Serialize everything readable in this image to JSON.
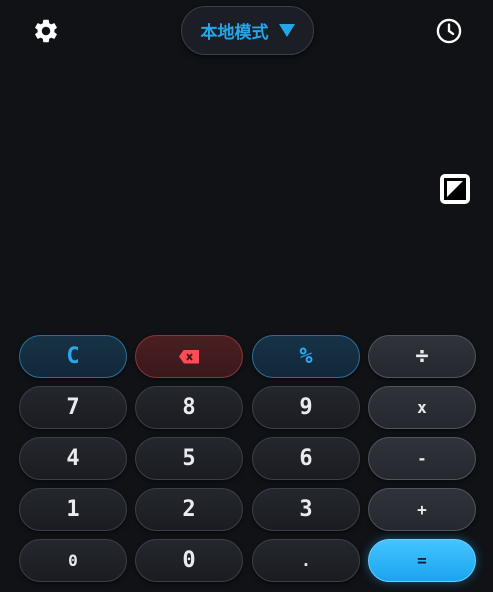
{
  "header": {
    "mode_label": "本地模式"
  },
  "icons": {
    "settings": "gear-icon",
    "history": "clock-icon",
    "mode_dropdown": "triangle-down-icon",
    "sign_toggle": "plus-minus-square-icon",
    "backspace": "backspace-icon"
  },
  "keypad": {
    "row1": [
      "C",
      "",
      "%",
      "÷"
    ],
    "row2": [
      "7",
      "8",
      "9",
      "x"
    ],
    "row3": [
      "4",
      "5",
      "6",
      "-"
    ],
    "row4": [
      "1",
      "2",
      "3",
      "+"
    ],
    "row5": [
      "0",
      "0",
      ".",
      "="
    ]
  },
  "colors": {
    "background": "#101216",
    "accent_blue": "#25a6ea",
    "equals_blue": "#2ab4f8",
    "delete_red": "#ff4b55"
  }
}
